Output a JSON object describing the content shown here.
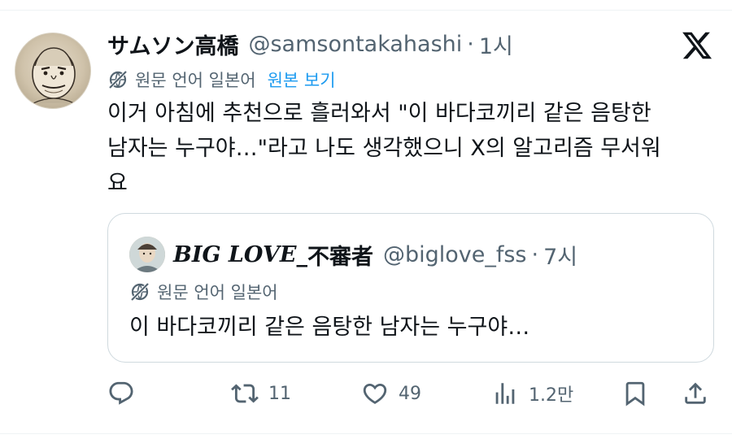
{
  "tweet": {
    "display_name": "サムソン高橋",
    "handle": "@samsontakahashi",
    "separator": "·",
    "time": "1시",
    "translation": {
      "language_label": "원문 언어 일본어",
      "show_original_link": "원본 보기"
    },
    "text": "이거 아침에 추천으로 흘러와서 \"이 바다코끼리 같은 음탕한\n남자는 누구야…\"라고 나도 생각했으니 X의 알고리즘 무서워\n요"
  },
  "quoted_tweet": {
    "display_name_latin": "BIG LOVE_",
    "display_name_cjk": "不審者",
    "handle": "@biglove_fss",
    "separator": "·",
    "time": "7시",
    "language_label": "원문 언어 일본어",
    "text": "이 바다코끼리 같은 음탕한 남자는 누구야…"
  },
  "actions": {
    "reply_count": "",
    "retweet_count": "11",
    "like_count": "49",
    "view_count": "1.2만"
  },
  "icons": {
    "brand": "x-logo-icon",
    "translate": "globe-off-icon",
    "reply": "reply-icon",
    "retweet": "retweet-icon",
    "like": "heart-icon",
    "views": "views-icon",
    "bookmark": "bookmark-icon",
    "share": "share-icon"
  },
  "colors": {
    "text_primary": "#0f1419",
    "text_secondary": "#536471",
    "link_blue": "#1d9bf0",
    "border": "#cfd9de"
  }
}
